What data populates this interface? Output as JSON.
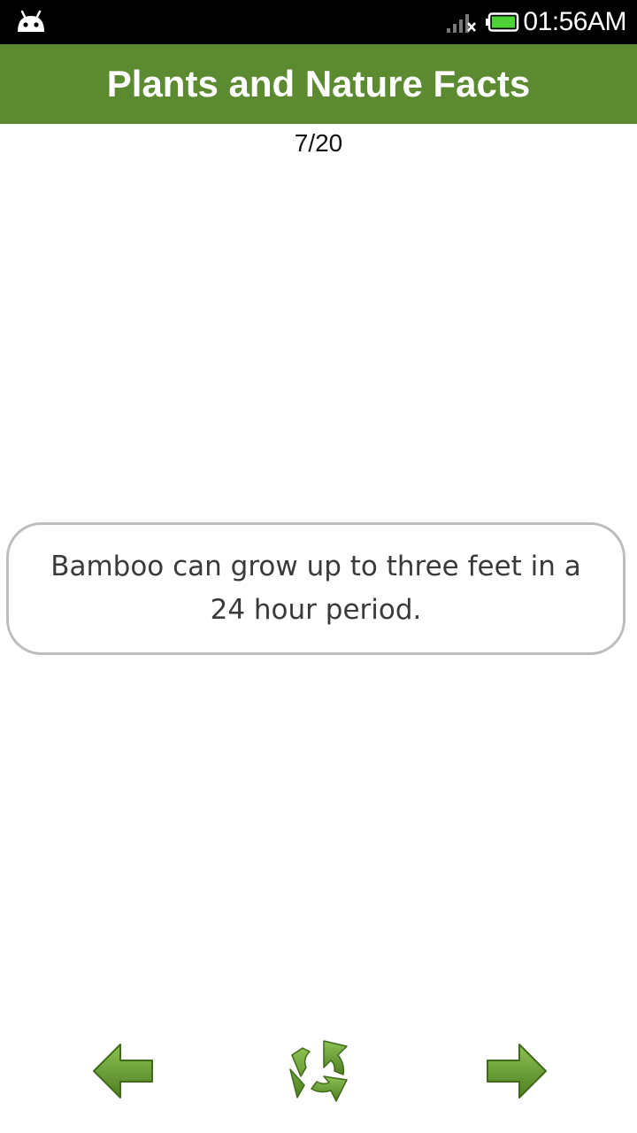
{
  "status_bar": {
    "time": "01:56AM",
    "icons": [
      "android-icon",
      "signal-icon",
      "battery-icon"
    ]
  },
  "header": {
    "title": "Plants and Nature Facts"
  },
  "counter": {
    "text": "7/20"
  },
  "fact": {
    "text": "Bamboo can grow up to three feet in a 24 hour period."
  },
  "navigation": {
    "icons": [
      "arrow-left-icon",
      "shuffle-icon",
      "arrow-right-icon"
    ]
  },
  "colors": {
    "title_bar": "#5b8a30",
    "button_green": "#5f9a2e",
    "card_border": "#bdbdbd",
    "battery_fill": "#4cd137"
  }
}
